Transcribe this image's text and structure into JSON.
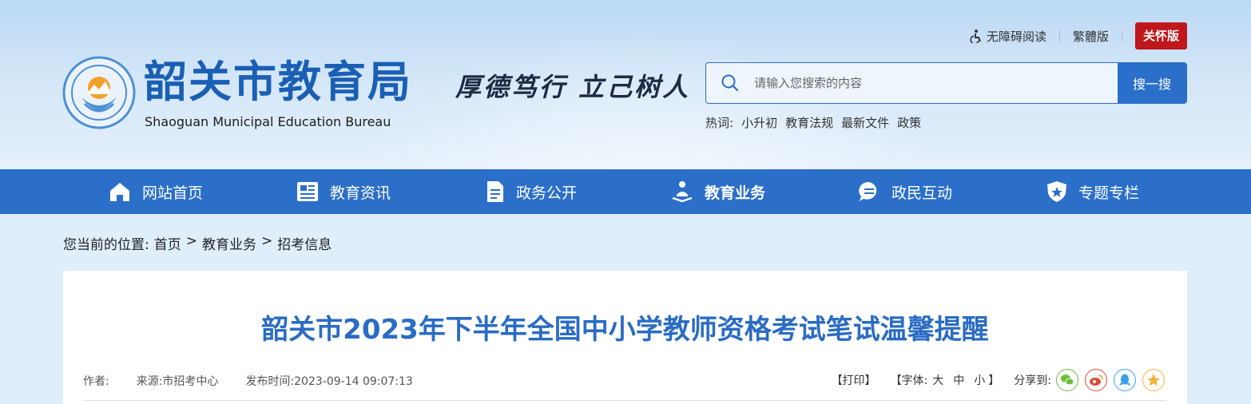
{
  "header": {
    "site_title": "韶关市教育局",
    "site_subtitle": "Shaoguan Municipal Education Bureau",
    "slogan": "厚德笃行  立己树人",
    "tools": {
      "accessibility": "无障碍阅读",
      "traditional": "繁體版",
      "care": "关怀版"
    },
    "search": {
      "placeholder": "请输入您搜索的内容",
      "button": "搜一搜"
    },
    "hotwords": {
      "label": "热词:",
      "items": [
        "小升初",
        "教育法规",
        "最新文件",
        "政策"
      ]
    }
  },
  "nav": {
    "items": [
      {
        "label": "网站首页",
        "icon": "home-icon"
      },
      {
        "label": "教育资讯",
        "icon": "newspaper-icon"
      },
      {
        "label": "政务公开",
        "icon": "document-icon"
      },
      {
        "label": "教育业务",
        "icon": "education-icon",
        "active": true
      },
      {
        "label": "政民互动",
        "icon": "chat-icon"
      },
      {
        "label": "专题专栏",
        "icon": "shield-star-icon"
      }
    ]
  },
  "breadcrumb": {
    "prefix": "您当前的位置:",
    "items": [
      "首页",
      "教育业务",
      "招考信息"
    ],
    "separator": ">"
  },
  "article": {
    "title": "韶关市2023年下半年全国中小学教师资格考试笔试温馨提醒",
    "author": "作者:",
    "source": "来源:市招考中心",
    "published": "发布时间:2023-09-14 09:07:13",
    "print": "【打印】",
    "font_label": "【字体:",
    "font_large": "大",
    "font_medium": "中",
    "font_small": "小",
    "font_close": "】",
    "share_label": "分享到:",
    "share_icons": [
      "wechat-icon",
      "weibo-icon",
      "qq-icon",
      "qzone-icon"
    ]
  },
  "colors": {
    "brand_blue": "#2b6fc9",
    "title_blue": "#2a6cc4",
    "care_red": "#c0171c"
  }
}
